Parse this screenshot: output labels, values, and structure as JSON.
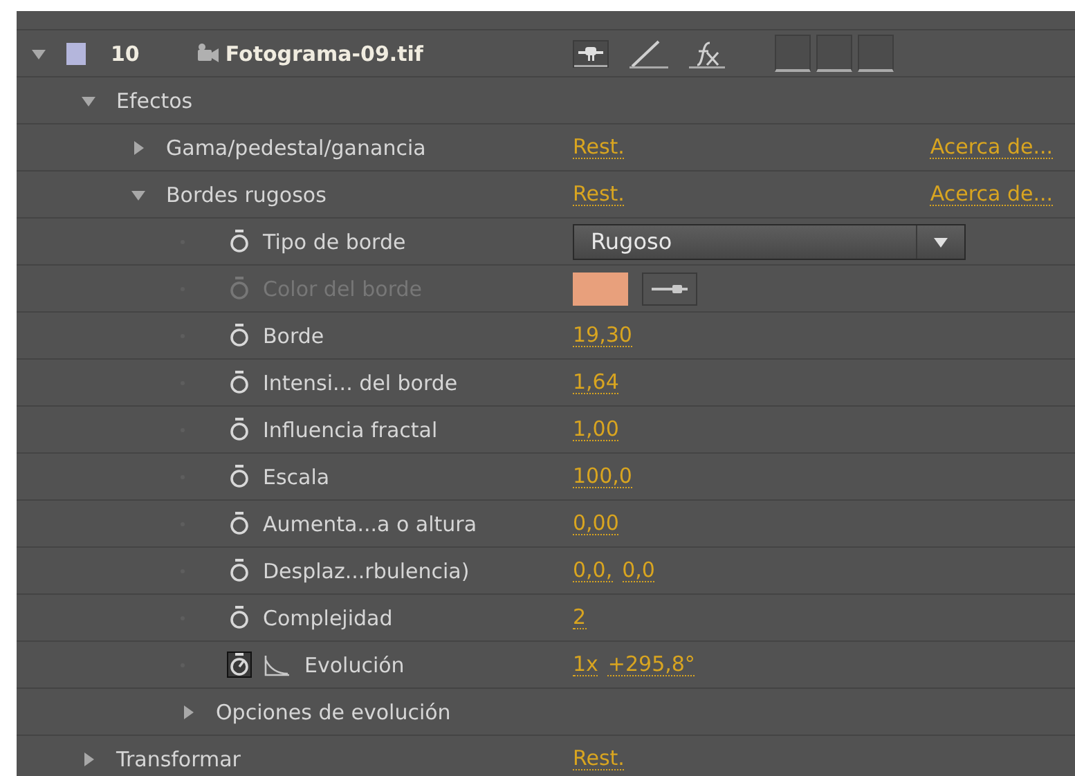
{
  "layer": {
    "number": "10",
    "name": "Fotograma-09.tif",
    "expanded": true,
    "color": "#b4b6dc"
  },
  "properties": [
    {
      "name": "Efectos",
      "expanded": true,
      "children": [
        {
          "name": "Gama/pedestal/ganancia",
          "expanded": false,
          "reset": "Rest.",
          "about": "Acerca de..."
        },
        {
          "name": "Bordes rugosos",
          "expanded": true,
          "reset": "Rest.",
          "about": "Acerca de...",
          "children": [
            {
              "kind": "dropdown",
              "name": "Tipo de borde",
              "disabled": false,
              "keyframed": false,
              "value": "Rugoso"
            },
            {
              "kind": "color",
              "name": "Color del borde",
              "disabled": true,
              "keyframed": false,
              "color": "#e8a07c"
            },
            {
              "kind": "number",
              "name": "Borde",
              "disabled": false,
              "keyframed": false,
              "values": [
                "19,30"
              ]
            },
            {
              "kind": "number",
              "name": "Intensi... del borde",
              "disabled": false,
              "keyframed": false,
              "values": [
                "1,64"
              ]
            },
            {
              "kind": "number",
              "name": "Influencia fractal",
              "disabled": false,
              "keyframed": false,
              "values": [
                "1,00"
              ]
            },
            {
              "kind": "number",
              "name": "Escala",
              "disabled": false,
              "keyframed": false,
              "values": [
                "100,0"
              ]
            },
            {
              "kind": "number",
              "name": "Aumenta...a o altura",
              "disabled": false,
              "keyframed": false,
              "values": [
                "0,00"
              ]
            },
            {
              "kind": "number",
              "name": "Desplaz...rbulencia)",
              "disabled": false,
              "keyframed": false,
              "values": [
                "0,0,",
                "0,0"
              ]
            },
            {
              "kind": "number",
              "name": "Complejidad",
              "disabled": false,
              "keyframed": false,
              "values": [
                "2"
              ]
            },
            {
              "kind": "angle",
              "name": "Evolución",
              "disabled": false,
              "keyframed": true,
              "values": [
                "1x",
                "+295,8°"
              ]
            },
            {
              "kind": "group",
              "name": "Opciones de evolución",
              "expanded": false
            }
          ]
        }
      ]
    },
    {
      "name": "Transformar",
      "expanded": false,
      "reset": "Rest."
    }
  ]
}
